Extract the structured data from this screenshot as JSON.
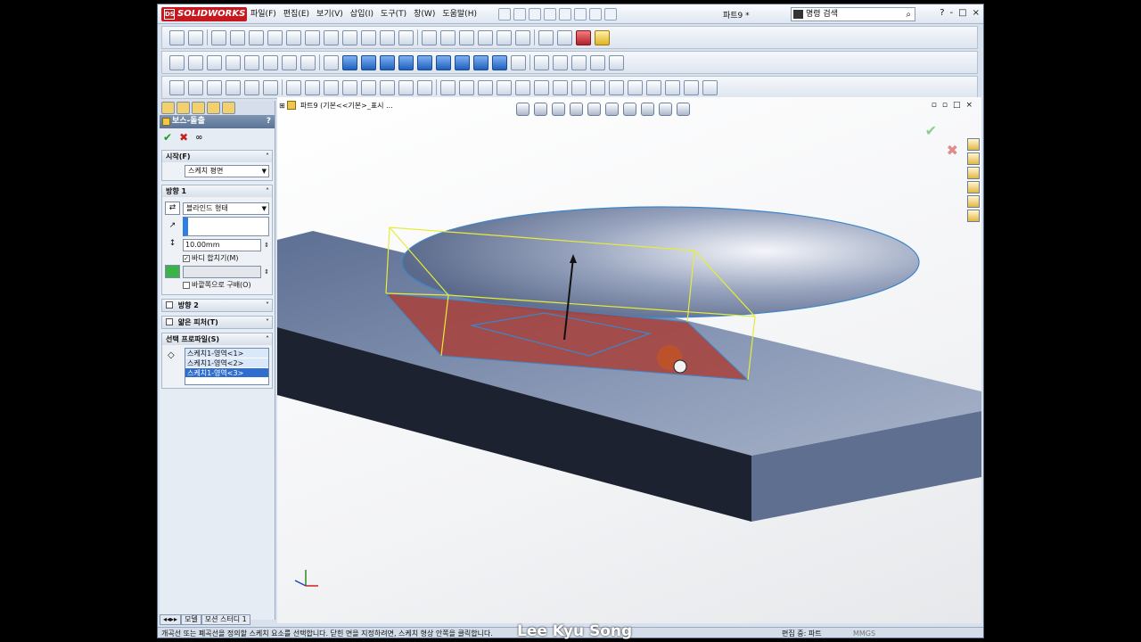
{
  "app": {
    "logo_text": "SOLIDWORKS",
    "logo_badge": "DS"
  },
  "menu": [
    "파일(F)",
    "편집(E)",
    "보기(V)",
    "삽입(I)",
    "도구(T)",
    "창(W)",
    "도움말(H)"
  ],
  "document_title": "파트9 *",
  "search": {
    "placeholder": "명령 검색"
  },
  "window_buttons": [
    "?",
    "-",
    "□",
    "×"
  ],
  "property_manager": {
    "title": "보스-돌출",
    "help": "?",
    "ok_symbol": "✔",
    "cancel_symbol": "✖",
    "preview_symbol": "&#8734;",
    "start_group": {
      "header": "시작(F)",
      "value": "스케치 평면"
    },
    "direction1": {
      "header": "방향 1",
      "end_condition": "블라인드 형태",
      "depth": "10.00mm",
      "merge_result_label": "바디 합치기(M)",
      "merge_result_checked": true,
      "draft_label": "바깥쪽으로 구배(O)",
      "draft_checked": false
    },
    "direction2": {
      "header": "방향 2",
      "checked": false
    },
    "thin_feature": {
      "header": "얇은 피처(T)",
      "checked": false
    },
    "selected_contours": {
      "header": "선택 프로파일(S)",
      "items": [
        {
          "label": "스케치1-영역<1>",
          "selected": false
        },
        {
          "label": "스케치1-영역<2>",
          "selected": false
        },
        {
          "label": "스케치1-영역<3>",
          "selected": true
        }
      ]
    }
  },
  "viewport": {
    "tree_label": "파트9 (기본<<기본>_표시 ...",
    "triad": {
      "x": "X",
      "y": "Y"
    }
  },
  "bottom_tabs": [
    "모델",
    "모션 스터디 1"
  ],
  "status_bar": {
    "message": "개곡선 또는 폐곡선을 정의할 스케치 요소를 선택합니다. 닫힌 면을 지정하려면, 스케치 형상 안쪽을 클릭합니다.",
    "mode": "편집 중: 파트",
    "units": "MMGS"
  },
  "watermark": "Lee Kyu Song",
  "colors": {
    "accent_red": "#c8181f",
    "model_face": "#6b7ea3",
    "sketch_region": "#a8413a",
    "preview_yellow": "#e7ec37"
  }
}
